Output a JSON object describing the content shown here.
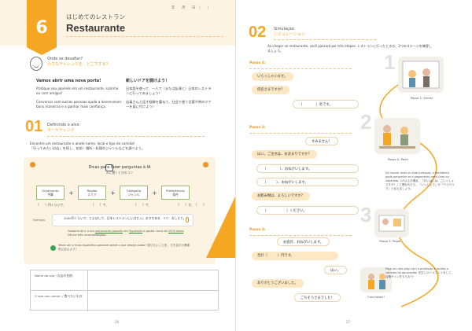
{
  "left": {
    "lesson_number": "6",
    "lesson_title_jp": "はじめてのレストラン",
    "lesson_title": "Restaurante",
    "date_line": "年　月　日（　）",
    "challenge": {
      "pt": "Onde se desafiar?",
      "jp": "小さなチャレンジを、どこでする？"
    },
    "col_left": {
      "title": "Vamos abrir uma nova porta!",
      "p1": "Pratique seu japonês em um restaurante, sozinho ou com amigos!",
      "p2": "Conversar com outras pessoas ajuda a desenvolver bons maneiras e a ganhar mais confiança."
    },
    "col_right": {
      "title": "新しいドアを開けよう！",
      "p1": "日本語を使って、一人で（または友達と）日本のレストランに行ってみましょう！",
      "p2": "店員さんと話す経験を重ねて、社会で使う言葉や時のマナーを身に付けよう！"
    },
    "section1": {
      "num": "01",
      "pt": "Definindo o alvo",
      "jp": "ターゲティング"
    },
    "instruction": {
      "pt": "Encontre um restaurante e anote nome, local e tipo de comida!",
      "jp": "「行ってみたいお店」を探し、名前・場所・料理のジャンルなどを調べよう。"
    },
    "tips": {
      "title": "Dicas para fazer perguntas à IA",
      "title_jp": "AIに聞くときのコツ",
      "boxes": [
        {
          "pt": "Orçamento",
          "jp": "予算"
        },
        {
          "pt": "Região",
          "jp": "エリア"
        },
        {
          "pt": "Categoria",
          "jp": "ジャンル"
        },
        {
          "pt": "Preferências",
          "jp": "条件"
        }
      ],
      "blanks": [
        "（　　）円くらいで、",
        "（　　）で、",
        "（　　）で、",
        "（　　）だ、（　　）"
      ],
      "example_label": "Exemplo",
      "example_text": "1000円くらいで、とよはしで、日本レストランにいきたい。おすすめを　3つ　おしえて。",
      "example_note_pre": "Gostaria de ir a um ",
      "example_note_u1": "restaurante japonês",
      "example_note_mid": " em ",
      "example_note_u2": "Toyohashi",
      "example_note_mid2": " e gastar cerca de ",
      "example_note_u3": "1000 ienes",
      "example_note_post": ". Dê-me três recomendações.",
      "check_text": "Tente ser o mais específico possível sobre o que deseja saber! 知りたいことを、できるだけ具体的に伝えよう！"
    },
    "form": {
      "row1": "Nome da loja / お店の名前：",
      "row2": "O que vou comer: / 食べたいもの："
    },
    "page_number": "26"
  },
  "right": {
    "section2": {
      "num": "02",
      "pt": "Simulação",
      "jp": "シミュレーション"
    },
    "intro": "Ao chegar no restaurante, você passará por três etapas. レストランに行ったときの、3つのステージを練習しましょう。",
    "passo1": {
      "label": "Passo 1:",
      "lines": [
        "いらっしゃいませ。",
        "何名さまですか？",
        "（　　　　）名です。"
      ]
    },
    "passo2": {
      "label": "Passo 2:",
      "lines": [
        "すみません！",
        "はい。ご注文は、お決まりですか？",
        "（　　　　）、おねがいします。",
        "（　　　）、おねがいします。",
        "お飲み物は、よろしいですか？",
        "（　　　　　　）ください。"
      ]
    },
    "passo3": {
      "label": "Passo 3:",
      "lines": [
        "お会計、おねがいします。",
        "合計（　　　）円です。",
        "はい。",
        "ありがとうございました。",
        "ごちそうさまでした！"
      ]
    },
    "steps": [
      {
        "num": "1",
        "caption": "Passo 1: Entrar"
      },
      {
        "num": "2",
        "caption": "Passo 2: Pedir"
      },
      {
        "num": "3",
        "caption": "Passo 3: Pagar"
      },
      {
        "num": "",
        "caption": "Concluído!!"
      }
    ],
    "note_pay": "Se houver duas ou mais pessoas, o atendente pode perguntar se o pagamento será junto ou separado. 2人以上の場合、「おいはいは、ごいっしょですか？」と聞かれたら、「いっしょで」か「べつべつで」と伝えましょう。",
    "note_done": "Faça um role-play com o professor e receba o carimbo de aprovação! 先生とロールプレイをして、合格サインをもらおう！",
    "page_number": "27"
  }
}
